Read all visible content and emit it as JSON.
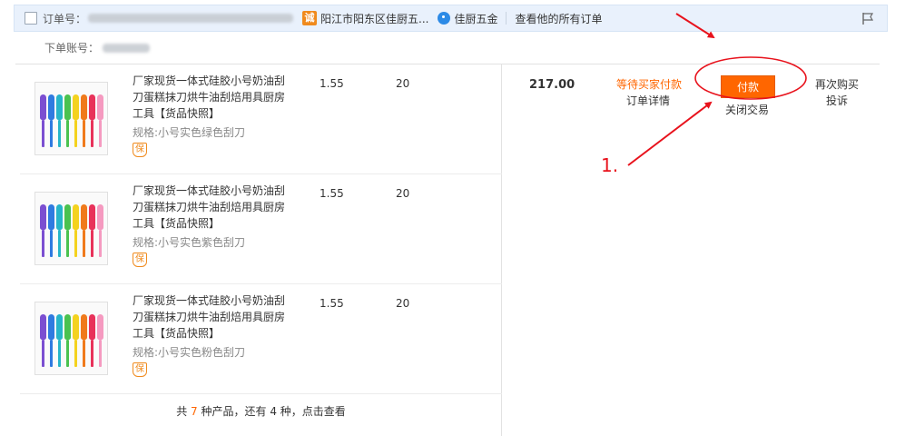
{
  "header": {
    "order_no_label": "订单号：",
    "shop_icon": "诚",
    "shop_name": "阳江市阳东区佳厨五...",
    "seller_name": "佳厨五金",
    "all_orders_link": "查看他的所有订单"
  },
  "buyer": {
    "label": "下单账号："
  },
  "items": [
    {
      "title": "厂家现货一体式硅胶小号奶油刮刀蛋糕抹刀烘牛油刮焙用具厨房工具",
      "snapshot": "【货品快照】",
      "spec": "规格:小号实色绿色刮刀",
      "guard_icon": "保",
      "price": "1.55",
      "qty": "20"
    },
    {
      "title": "厂家现货一体式硅胶小号奶油刮刀蛋糕抹刀烘牛油刮焙用具厨房工具",
      "snapshot": "【货品快照】",
      "spec": "规格:小号实色紫色刮刀",
      "guard_icon": "保",
      "price": "1.55",
      "qty": "20"
    },
    {
      "title": "厂家现货一体式硅胶小号奶油刮刀蛋糕抹刀烘牛油刮焙用具厨房工具",
      "snapshot": "【货品快照】",
      "spec": "规格:小号实色粉色刮刀",
      "guard_icon": "保",
      "price": "1.55",
      "qty": "20"
    }
  ],
  "more": {
    "prefix": "共 ",
    "count": "7",
    "middle": " 种产品，还有 4 种，点击查看"
  },
  "summary": {
    "total": "217.00",
    "status": "等待买家付款",
    "detail_link": "订单详情",
    "pay_button": "付款",
    "close_link": "关闭交易",
    "rebuy_link": "再次购买",
    "complain_link": "投诉"
  },
  "annotation": {
    "label": "1."
  },
  "colors": {
    "accent": "#ff6600",
    "header_bg": "#e9f1fc",
    "annotation": "#e8121c"
  },
  "spatula_colors": [
    "#7b4fd1",
    "#2f7be0",
    "#27b5c9",
    "#4ac24f",
    "#f4d21f",
    "#f07a1c",
    "#e8325a",
    "#f59ac0"
  ]
}
